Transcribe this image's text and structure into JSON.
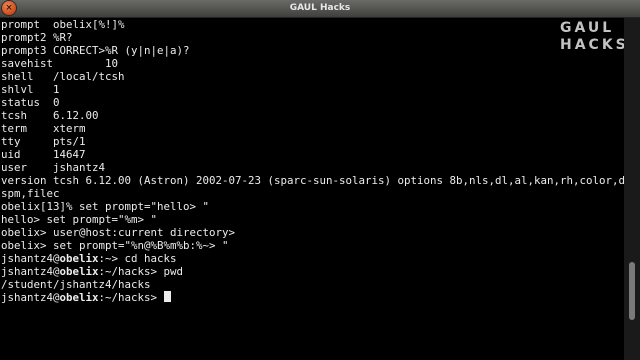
{
  "window": {
    "title": "GAUL Hacks",
    "close_symbol": "×"
  },
  "logo": {
    "line1": "GAUL",
    "line2": "HACKS"
  },
  "terminal": {
    "lines": [
      "prompt  obelix[%!]%",
      "prompt2 %R?",
      "prompt3 CORRECT>%R (y|n|e|a)?",
      "savehist        10",
      "shell   /local/tcsh",
      "shlvl   1",
      "status  0",
      "tcsh    6.12.00",
      "term    xterm",
      "tty     pts/1",
      "uid     14647",
      "user    jshantz4",
      "version tcsh 6.12.00 (Astron) 2002-07-23 (sparc-sun-solaris) options 8b,nls,dl,al,kan,rh,color,d",
      "spm,filec",
      "obelix[13]% set prompt=\"hello> \"",
      "hello> set prompt=\"%m> \"",
      "obelix> user@host:current directory>",
      "obelix> set prompt=\"%n@%B%m%b:%~> \""
    ],
    "prompt_lines": [
      {
        "user": "jshantz4@",
        "host": "obelix",
        "rest": ":~> cd hacks"
      },
      {
        "user": "jshantz4@",
        "host": "obelix",
        "rest": ":~/hacks> pwd"
      }
    ],
    "output_line": "/student/jshantz4/hacks",
    "last_prompt": {
      "user": "jshantz4@",
      "host": "obelix",
      "rest": ":~/hacks> "
    }
  }
}
